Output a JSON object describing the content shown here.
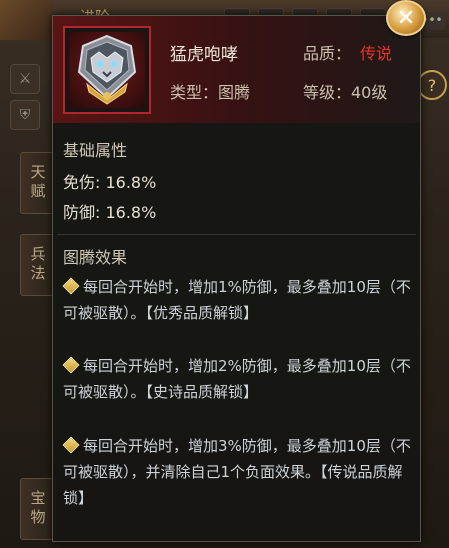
{
  "background": {
    "top_tab": "进阶",
    "side_tabs": [
      "天赋",
      "兵法",
      "宝物"
    ],
    "help_glyph": "?",
    "menu_glyph": "•••"
  },
  "item": {
    "icon": "tiger-totem-medal-icon",
    "name": "猛虎咆哮",
    "quality_label": "品质：",
    "quality_value": "传说",
    "type_text": "类型：图腾",
    "level_text": "等级：40级"
  },
  "base_attributes": {
    "title": "基础属性",
    "lines": [
      "免伤: 16.8%",
      "防御: 16.8%"
    ]
  },
  "totem_effects": {
    "title": "图腾效果",
    "entries": [
      "每回合开始时，增加1%防御，最多叠加10层（不可被驱散）。【优秀品质解锁】",
      "每回合开始时，增加2%防御，最多叠加10层（不可被驱散）。【史诗品质解锁】",
      "每回合开始时，增加3%防御，最多叠加10层（不可被驱散），并清除自己1个负面效果。【传说品质解锁】"
    ]
  },
  "close_glyph": "✕",
  "colors": {
    "legendary_red": "#e8342c",
    "header_red": "#5a1414",
    "effect_text": "#cdd3d8"
  }
}
